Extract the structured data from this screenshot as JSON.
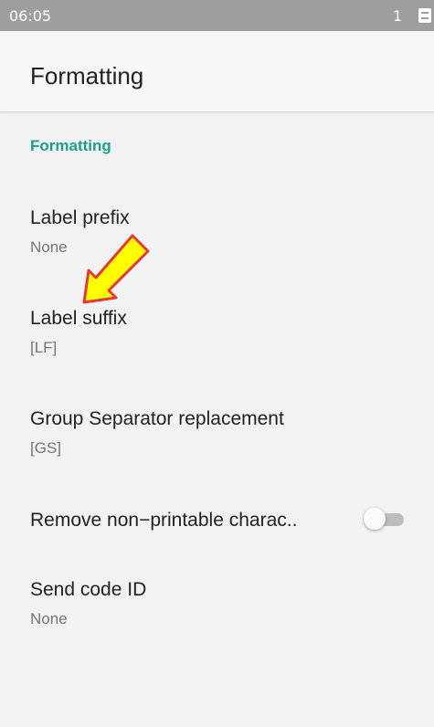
{
  "status_bar": {
    "time": "06:05",
    "notification_count": "1"
  },
  "app_bar": {
    "title": "Formatting"
  },
  "category": {
    "title": "Formatting",
    "color": "#1b9e8e"
  },
  "preferences": [
    {
      "title": "Label prefix",
      "summary": "None"
    },
    {
      "title": "Label suffix",
      "summary": "[LF]"
    },
    {
      "title": "Group Separator replacement",
      "summary": "[GS]"
    },
    {
      "title": "Remove non−printable charac..",
      "switch_on": false
    },
    {
      "title": "Send code ID",
      "summary": "None"
    }
  ],
  "annotation": {
    "icon": "arrow-icon",
    "fill_color": "#ffff00",
    "outline_color": "#e53935"
  }
}
